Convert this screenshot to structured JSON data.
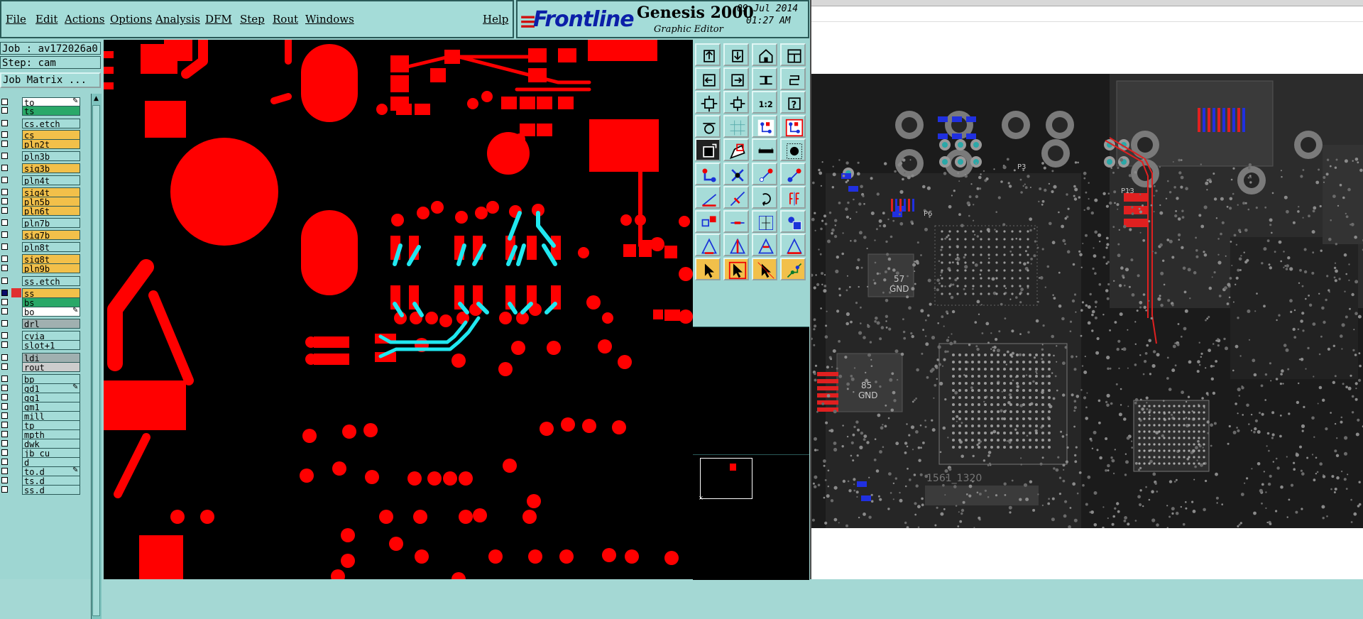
{
  "menu": {
    "items": [
      {
        "id": "file",
        "label": "File"
      },
      {
        "id": "edit",
        "label": "Edit"
      },
      {
        "id": "actions",
        "label": "Actions"
      },
      {
        "id": "options",
        "label": "Options"
      },
      {
        "id": "analysis",
        "label": "Analysis"
      },
      {
        "id": "dfm",
        "label": "DFM"
      },
      {
        "id": "step",
        "label": "Step"
      },
      {
        "id": "rout",
        "label": "Rout"
      },
      {
        "id": "windows",
        "label": "Windows"
      }
    ],
    "help": "Help"
  },
  "header": {
    "brand": "Frontline",
    "product": "Genesis 2000",
    "subtitle": "Graphic Editor",
    "date": "09 Jul 2014",
    "time": "01:27 AM"
  },
  "job": {
    "job_label": "Job : av172026a0",
    "step_label": "Step: cam",
    "matrix_button": "Job Matrix ..."
  },
  "layers": [
    {
      "name": "to",
      "color": "#ffffff",
      "pen": true
    },
    {
      "name": "ts",
      "color": "#2aa868"
    },
    {
      "name": "cs.etch",
      "color": "#a4dcd8"
    },
    {
      "name": "cs",
      "color": "#f2c04a"
    },
    {
      "name": "pln2t",
      "color": "#f2c04a"
    },
    {
      "name": "pln3b",
      "color": "#a4dcd8"
    },
    {
      "name": "sig3b",
      "color": "#f2c04a"
    },
    {
      "name": "pln4t",
      "color": "#a4dcd8"
    },
    {
      "name": "sig4t",
      "color": "#f2c04a"
    },
    {
      "name": "pln5b",
      "color": "#f2c04a"
    },
    {
      "name": "pln6t",
      "color": "#f2c04a"
    },
    {
      "name": "pln7b",
      "color": "#a4dcd8"
    },
    {
      "name": "sig7b",
      "color": "#f2c04a"
    },
    {
      "name": "pln8t",
      "color": "#a4dcd8"
    },
    {
      "name": "sig8t",
      "color": "#f2c04a"
    },
    {
      "name": "pln9b",
      "color": "#f2c04a"
    },
    {
      "name": "ss.etch",
      "color": "#a4dcd8"
    },
    {
      "name": "ss",
      "color": "#f2c04a",
      "active": true
    },
    {
      "name": "bs",
      "color": "#2aa868"
    },
    {
      "name": "bo",
      "color": "#ffffff",
      "pen": true
    },
    {
      "name": "drl",
      "color": "#a0b0b0"
    },
    {
      "name": "cvia",
      "color": "#a4dcd8"
    },
    {
      "name": "slot+1",
      "color": "#a4dcd8"
    },
    {
      "name": "ldi",
      "color": "#a0b0b0"
    },
    {
      "name": "rout",
      "color": "#cccccc"
    },
    {
      "name": "bp",
      "color": "#a4dcd8"
    },
    {
      "name": "gd1",
      "color": "#a4dcd8",
      "pen": true
    },
    {
      "name": "gg1",
      "color": "#a4dcd8"
    },
    {
      "name": "gm1",
      "color": "#a4dcd8"
    },
    {
      "name": "mill",
      "color": "#a4dcd8"
    },
    {
      "name": "tp",
      "color": "#a4dcd8"
    },
    {
      "name": "mpth",
      "color": "#a4dcd8"
    },
    {
      "name": "dwk",
      "color": "#a4dcd8"
    },
    {
      "name": "jb_cu",
      "color": "#a4dcd8"
    },
    {
      "name": "d",
      "color": "#a4dcd8"
    },
    {
      "name": "to.d",
      "color": "#a4dcd8",
      "pen": true
    },
    {
      "name": "ts.d",
      "color": "#a4dcd8"
    },
    {
      "name": "ss.d",
      "color": "#a4dcd8"
    }
  ],
  "toolbox": {
    "buttons": [
      "layer-up-icon",
      "layer-down-icon",
      "home-icon",
      "window-icon",
      "pan-left-icon",
      "pan-right-icon",
      "swap-icon",
      "redraw-icon",
      "zoom-fit-icon",
      "zoom-home-icon",
      "zoom-1-2-icon",
      "query-icon",
      "snap-icon",
      "grid-icon",
      "display-mode-icon",
      "display-mode-red-icon",
      "pad-select-icon",
      "shape-icon",
      "line-icon",
      "circle-pad-icon",
      "connect-icon",
      "delete-node-icon",
      "add-point-icon",
      "select-point-icon",
      "pencil-red-icon",
      "pencil-blue-icon",
      "rotate-icon",
      "mirror-icon",
      "attr-icon",
      "cut-icon",
      "measure-icon",
      "group-icon",
      "triangle-a-icon",
      "triangle-b-icon",
      "triangle-c-icon",
      "triangle-d-icon",
      "pointer-icon",
      "pointer-red-icon",
      "pointer-box-icon",
      "net-pointer-icon"
    ],
    "zoom_label": "1:2",
    "query_label": "?"
  },
  "colors": {
    "copper": "#ff0000",
    "highlight": "#20e8f0",
    "panel": "#a4dcd8",
    "pcb_bg": "#1b1b1b"
  },
  "viewer": {
    "labels": [
      "P3",
      "P13",
      "P6",
      "57",
      "GND",
      "85",
      "GND",
      "1561_1320"
    ]
  }
}
